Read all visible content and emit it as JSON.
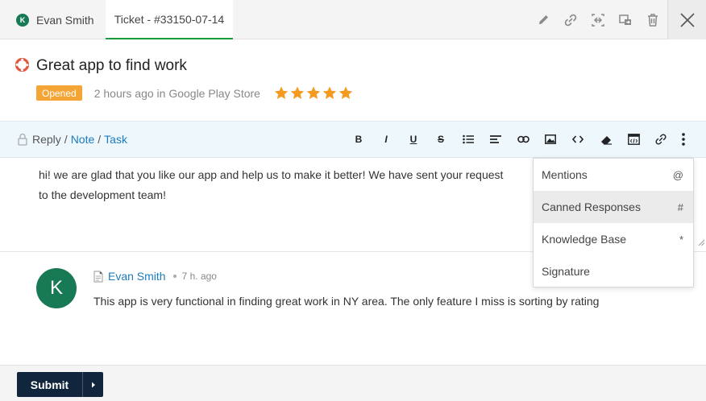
{
  "tabs": {
    "contact": {
      "avatar_initial": "K",
      "name": "Evan Smith"
    },
    "ticket": {
      "label": "Ticket - #33150-07-14"
    }
  },
  "toolbar_icons": [
    "pencil-icon",
    "link-icon",
    "merge-icon",
    "move-icon",
    "trash-icon",
    "close-icon"
  ],
  "ticket": {
    "title": "Great app to find work",
    "status": "Opened",
    "meta": "2 hours ago in Google Play Store",
    "rating": 5,
    "colors": {
      "status": "#f4a535",
      "star": "#f59a1e"
    }
  },
  "reply": {
    "mode_reply": "Reply",
    "sep1": "/",
    "mode_note": "Note",
    "sep2": "/",
    "mode_task": "Task",
    "format_buttons": [
      "B",
      "I",
      "U",
      "S"
    ],
    "editor_text": "hi! we are glad that you like our app and help us to make it better! We have sent your request to the development team!"
  },
  "insert_menu": {
    "items": [
      {
        "label": "Mentions",
        "key": "@"
      },
      {
        "label": "Canned Responses",
        "key": "#"
      },
      {
        "label": "Knowledge Base",
        "key": "*"
      },
      {
        "label": "Signature",
        "key": ""
      }
    ],
    "active_index": 1
  },
  "message": {
    "avatar_initial": "K",
    "author": "Evan Smith",
    "time": "7 h. ago",
    "body": "This app is very functional in finding great work in NY area. The only feature I miss is sorting by rating"
  },
  "footer": {
    "submit_label": "Submit"
  },
  "colors": {
    "accent_green": "#177a55",
    "link_blue": "#1a7cbf",
    "submit_bg": "#11263c"
  }
}
